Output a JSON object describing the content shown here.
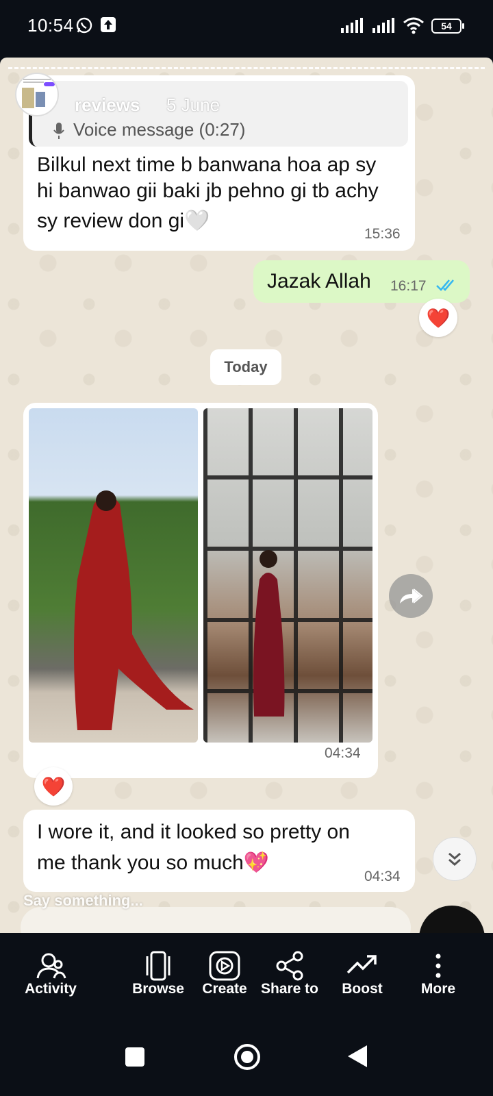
{
  "status": {
    "time": "10:54",
    "battery": "54",
    "icons": [
      "whatsapp-icon",
      "upload-icon",
      "signal-icon",
      "signal-icon",
      "wifi-icon",
      "battery-icon"
    ]
  },
  "chat": {
    "reply_quote": {
      "name": "reviews",
      "date": "5 June",
      "voice": "Voice message (0:27)"
    },
    "message1": {
      "line1": "Bilkul next time b banwana hoa ap sy",
      "line2": "hi banwao gii baki jb pehno gi tb achy",
      "line3": "sy review don gi🤍",
      "time": "15:36"
    },
    "message2": {
      "text": "Jazak Allah",
      "time": "16:17",
      "reaction": "❤️"
    },
    "date_divider": "Today",
    "photos_message": {
      "time": "04:34",
      "reaction": "❤️"
    },
    "message3": {
      "line1": "I wore it, and it looked so pretty on",
      "line2": "me thank you so much💖",
      "time": "04:34"
    }
  },
  "story": {
    "reply_placeholder": "Say something..."
  },
  "actions": [
    {
      "label": "Activity",
      "icon": "activity-icon"
    },
    {
      "label": "Browse",
      "icon": "browse-icon"
    },
    {
      "label": "Create",
      "icon": "create-icon"
    },
    {
      "label": "Share to",
      "icon": "share-icon"
    },
    {
      "label": "Boost",
      "icon": "boost-icon"
    },
    {
      "label": "More",
      "icon": "more-icon"
    }
  ],
  "colors": {
    "incoming_bubble": "#ffffff",
    "outgoing_bubble": "#dcf8c6",
    "read_ticks": "#34b7f1",
    "dark_bg": "#0b0f16"
  }
}
